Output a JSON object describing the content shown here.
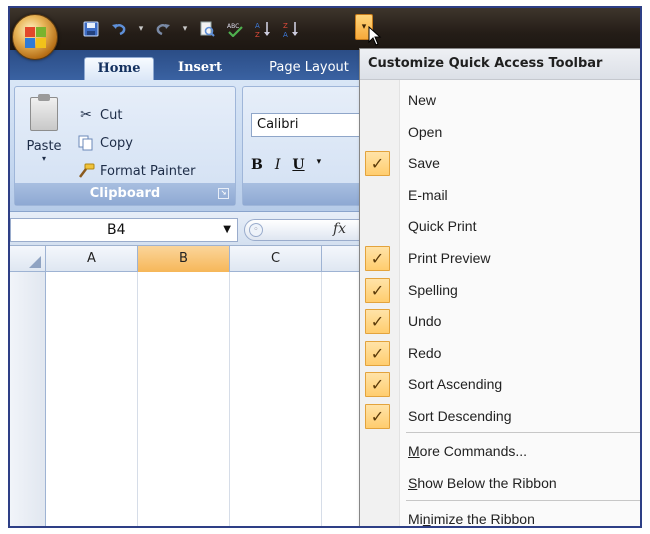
{
  "ribbon": {
    "tabs": [
      "Home",
      "Insert",
      "Page Layout"
    ],
    "clipboard": {
      "paste_label": "Paste",
      "cut_label": "Cut",
      "copy_label": "Copy",
      "format_painter_label": "Format Painter",
      "group_label": "Clipboard"
    },
    "font": {
      "font_name": "Calibri",
      "bold": "B",
      "italic": "I",
      "underline": "U"
    }
  },
  "formula_bar": {
    "name_box": "B4",
    "fx_label": "fx"
  },
  "grid": {
    "columns": [
      "A",
      "B",
      "C"
    ],
    "selected_column": "B"
  },
  "menu": {
    "title": "Customize Quick Access Toolbar",
    "items": [
      {
        "label": "New",
        "checked": false
      },
      {
        "label": "Open",
        "checked": false
      },
      {
        "label": "Save",
        "checked": true
      },
      {
        "label": "E-mail",
        "checked": false
      },
      {
        "label": "Quick Print",
        "checked": false
      },
      {
        "label": "Print Preview",
        "checked": true
      },
      {
        "label": "Spelling",
        "checked": true
      },
      {
        "label": "Undo",
        "checked": true
      },
      {
        "label": "Redo",
        "checked": true
      },
      {
        "label": "Sort Ascending",
        "checked": true
      },
      {
        "label": "Sort Descending",
        "checked": true
      }
    ],
    "more_commands": {
      "pre": "",
      "key": "M",
      "post": "ore Commands..."
    },
    "show_below": {
      "pre": "",
      "key": "S",
      "post": "how Below the Ribbon"
    },
    "minimize": {
      "pre": "Mi",
      "key": "n",
      "post": "imize the Ribbon"
    },
    "check_glyph": "✓"
  },
  "colors": {
    "accent_orange": "#f6b759",
    "check_bg": "#ffcd6e",
    "tab_bar": "#3a62a2",
    "frame_border": "#2e3f86"
  }
}
